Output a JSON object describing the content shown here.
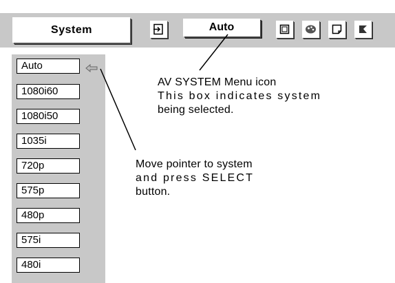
{
  "menubar": {
    "title": "System",
    "selected_system": "Auto",
    "icons": [
      "input-icon",
      "square-icon",
      "palette-icon",
      "screen-icon",
      "setting-icon"
    ]
  },
  "system_list": {
    "items": [
      "Auto",
      "1080i60",
      "1080i50",
      "1035i",
      "720p",
      "575p",
      "480p",
      "575i",
      "480i"
    ],
    "pointer_on": "Auto"
  },
  "annotations": {
    "menu_icon": {
      "line1": "AV SYSTEM Menu icon",
      "line2": "This box indicates system",
      "line3": "being selected."
    },
    "pointer": {
      "line1": "Move pointer to system",
      "line2": "and press SELECT",
      "line3": "button."
    }
  }
}
